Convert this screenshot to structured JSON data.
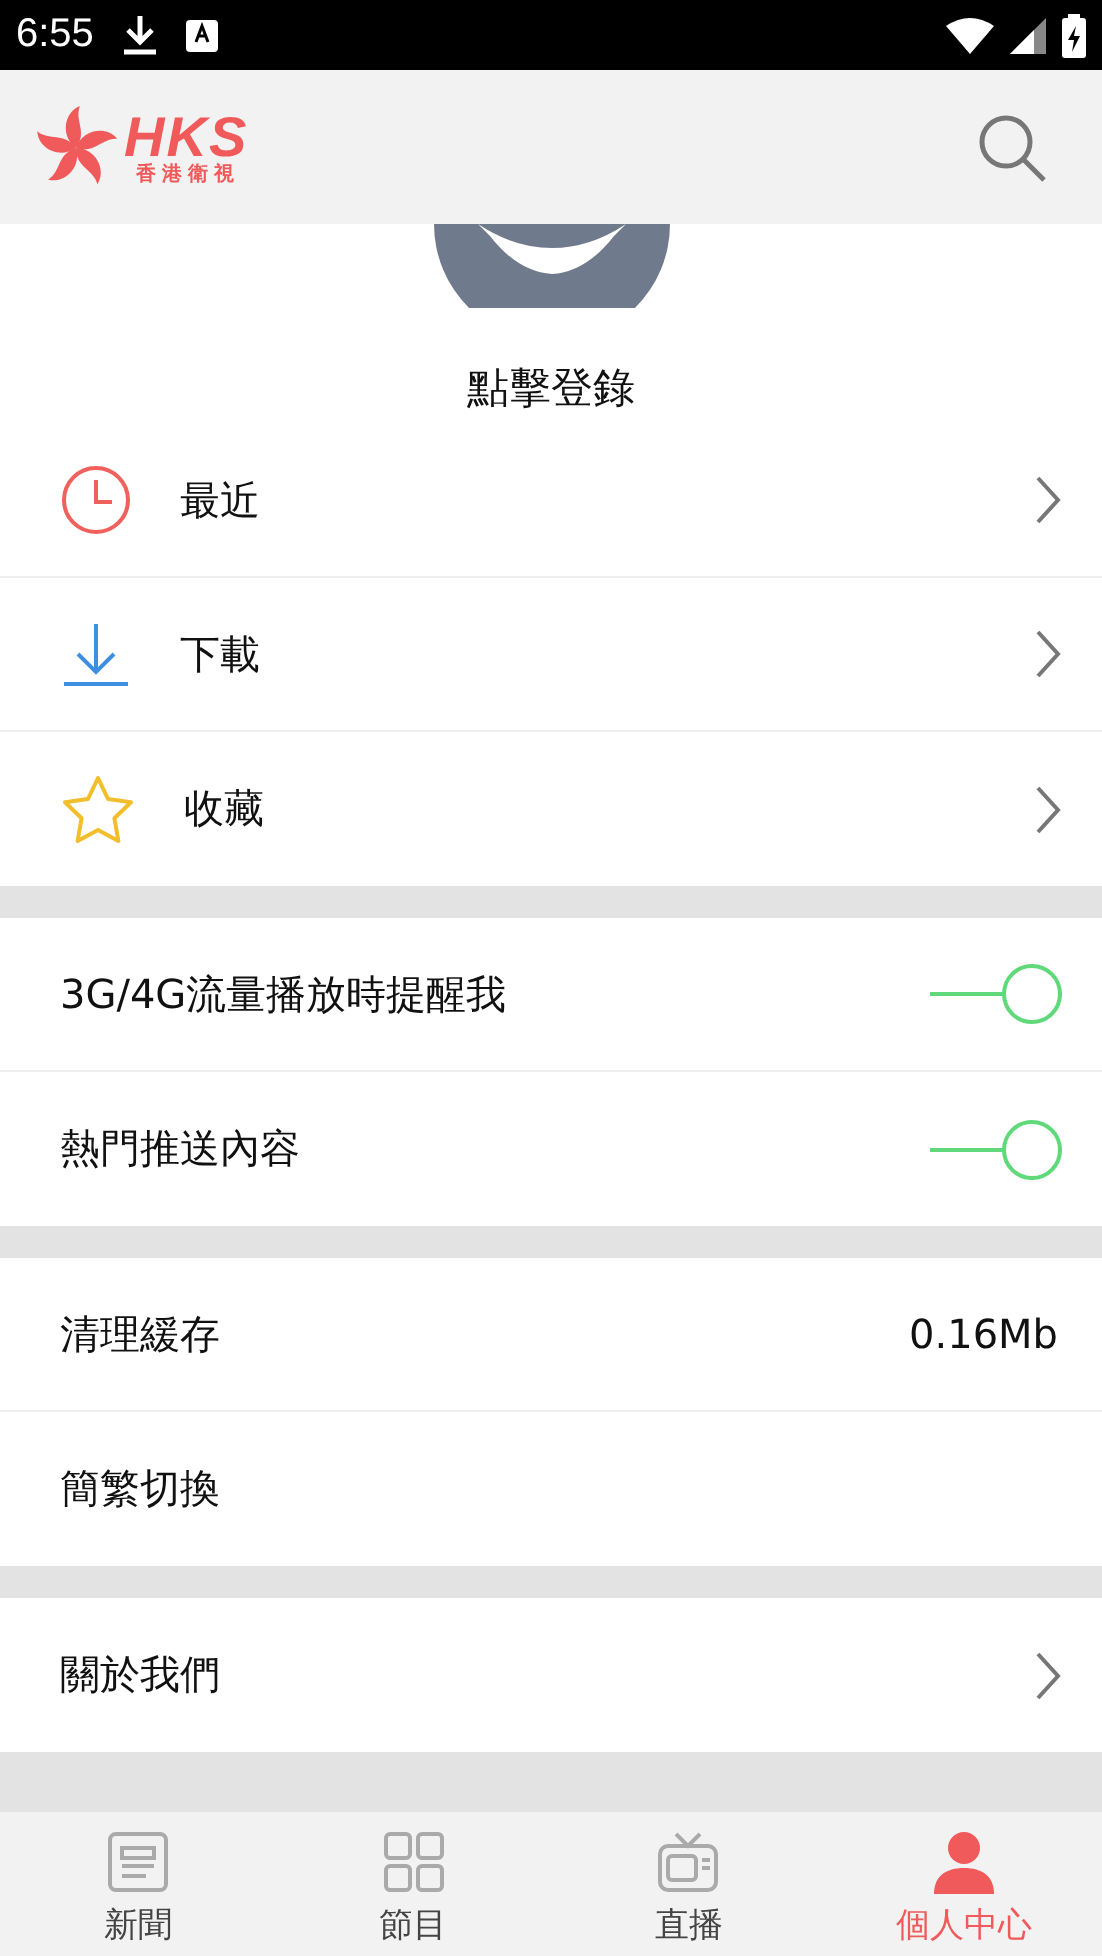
{
  "status_bar": {
    "time": "6:55"
  },
  "header": {
    "logo": {
      "name": "HKS",
      "subtitle": "香港衛視"
    }
  },
  "profile": {
    "login": "點擊登錄"
  },
  "sections": [
    {
      "rows": [
        {
          "kind": "link",
          "label": "最近"
        },
        {
          "kind": "link",
          "label": "下載"
        },
        {
          "kind": "link",
          "label": "收藏"
        }
      ]
    },
    {
      "rows": [
        {
          "kind": "toggle",
          "label": "3G/4G流量播放時提醒我",
          "on": true
        },
        {
          "kind": "toggle",
          "label": "熱門推送內容",
          "on": true
        }
      ]
    },
    {
      "rows": [
        {
          "kind": "value",
          "label": "清理緩存",
          "value": "0.16Mb"
        },
        {
          "kind": "plain",
          "label": "簡繁切換"
        }
      ]
    },
    {
      "rows": [
        {
          "kind": "link",
          "label": "關於我們"
        }
      ]
    }
  ],
  "tabs": [
    {
      "label": "新聞",
      "selected": false
    },
    {
      "label": "節目",
      "selected": false
    },
    {
      "label": "直播",
      "selected": false
    },
    {
      "label": "個人中心",
      "selected": true
    }
  ]
}
